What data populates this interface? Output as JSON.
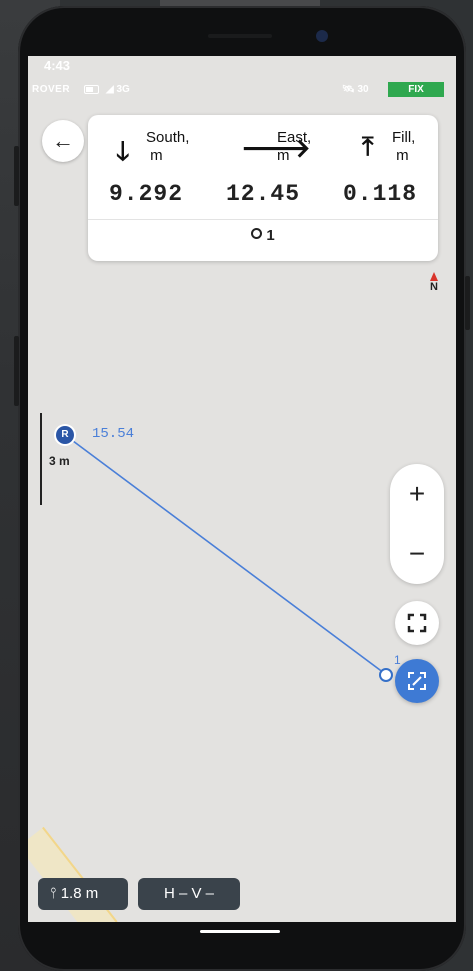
{
  "status_bar": {
    "time": "4:43",
    "mode": "ROVER",
    "network": "◢ 3G",
    "satellites": "30",
    "fix_status": "FIX",
    "fix_color": "#2fa84f"
  },
  "info_card": {
    "columns": [
      {
        "label_line1": "South,",
        "label_line2": "m",
        "value": "9.292",
        "icon": "arrow-down-icon"
      },
      {
        "label_line1": "East,",
        "label_line2": "m",
        "value": "12.45",
        "icon": "arrow-right-icon"
      },
      {
        "label_line1": "Fill,",
        "label_line2": "m",
        "value": "0.118",
        "icon": "arrow-up-to-line-icon"
      }
    ],
    "point_name": "1"
  },
  "map": {
    "north_label": "N",
    "scale_label": "3 m",
    "base_marker_label": "R",
    "base_distance": "15.54",
    "target_point_label": "1",
    "line_color": "#4a7fd8"
  },
  "controls": {
    "zoom_in": "+",
    "zoom_out": "−"
  },
  "bottom_bar": {
    "pole_height": "1.8 m",
    "precision": "H –  V –"
  }
}
